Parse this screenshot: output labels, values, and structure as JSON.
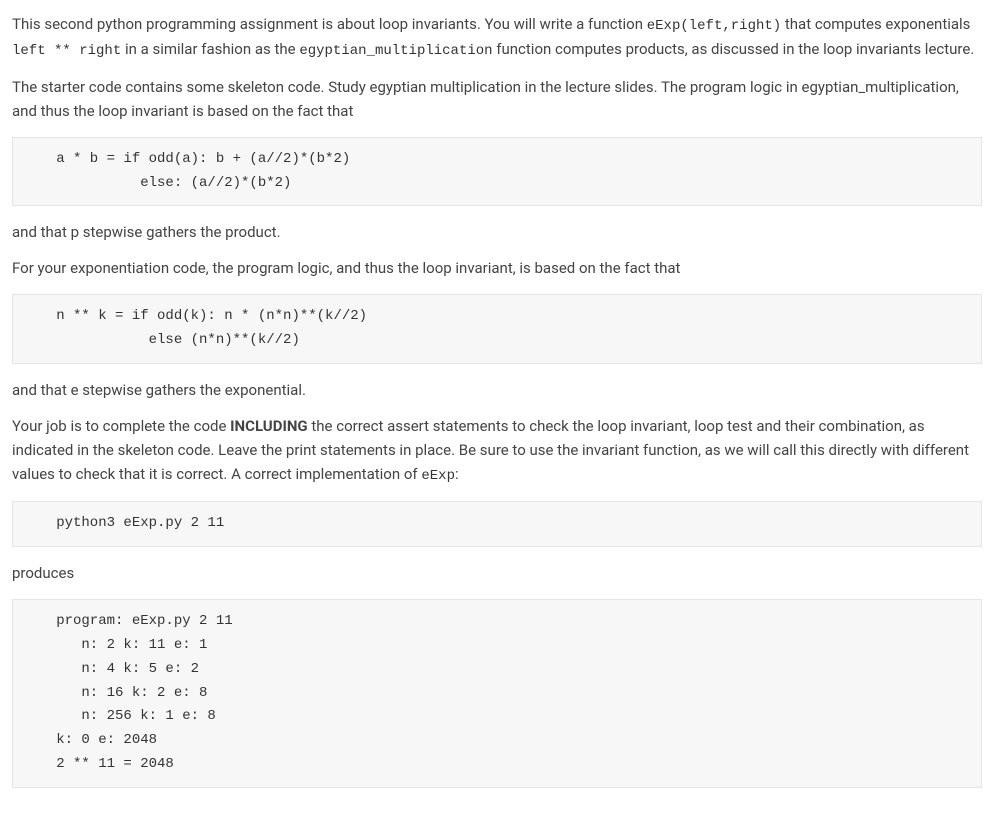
{
  "para1": {
    "t1": "This second python programming assignment is about loop invariants. You will write a function ",
    "c1": "eExp(left,right)",
    "t2": " that computes exponentials ",
    "c2": "left ** right",
    "t3": " in a similar fashion as the ",
    "c3": "egyptian_multiplication",
    "t4": " function computes products, as discussed in the loop invariants lecture."
  },
  "para2": "The starter code contains some skeleton code. Study egyptian multiplication in the lecture slides. The program logic in egyptian_multiplication, and thus the loop invariant is based on the fact that",
  "code1": "   a * b = if odd(a): b + (a//2)*(b*2)\n             else: (a//2)*(b*2)",
  "para3": "and that p stepwise gathers the product.",
  "para4": "For your exponentiation code, the program logic, and thus the loop invariant, is based on the fact that",
  "code2": "   n ** k = if odd(k): n * (n*n)**(k//2)\n              else (n*n)**(k//2)",
  "para5": "and that e stepwise gathers the exponential.",
  "para6": {
    "t1": "Your job is to complete the code ",
    "b1": "INCLUDING",
    "t2": " the correct assert statements to check the loop invariant, loop test and their combination, as indicated in the skeleton code. Leave the print statements in place. Be sure to use the invariant function, as we will call this directly with different values to check that it is correct. A correct implementation of ",
    "c1": "eExp",
    "t3": ":"
  },
  "code3": "   python3 eExp.py 2 11",
  "para7": "produces",
  "code4": "   program: eExp.py 2 11\n      n: 2 k: 11 e: 1\n      n: 4 k: 5 e: 2\n      n: 16 k: 2 e: 8\n      n: 256 k: 1 e: 8\n   k: 0 e: 2048\n   2 ** 11 = 2048"
}
